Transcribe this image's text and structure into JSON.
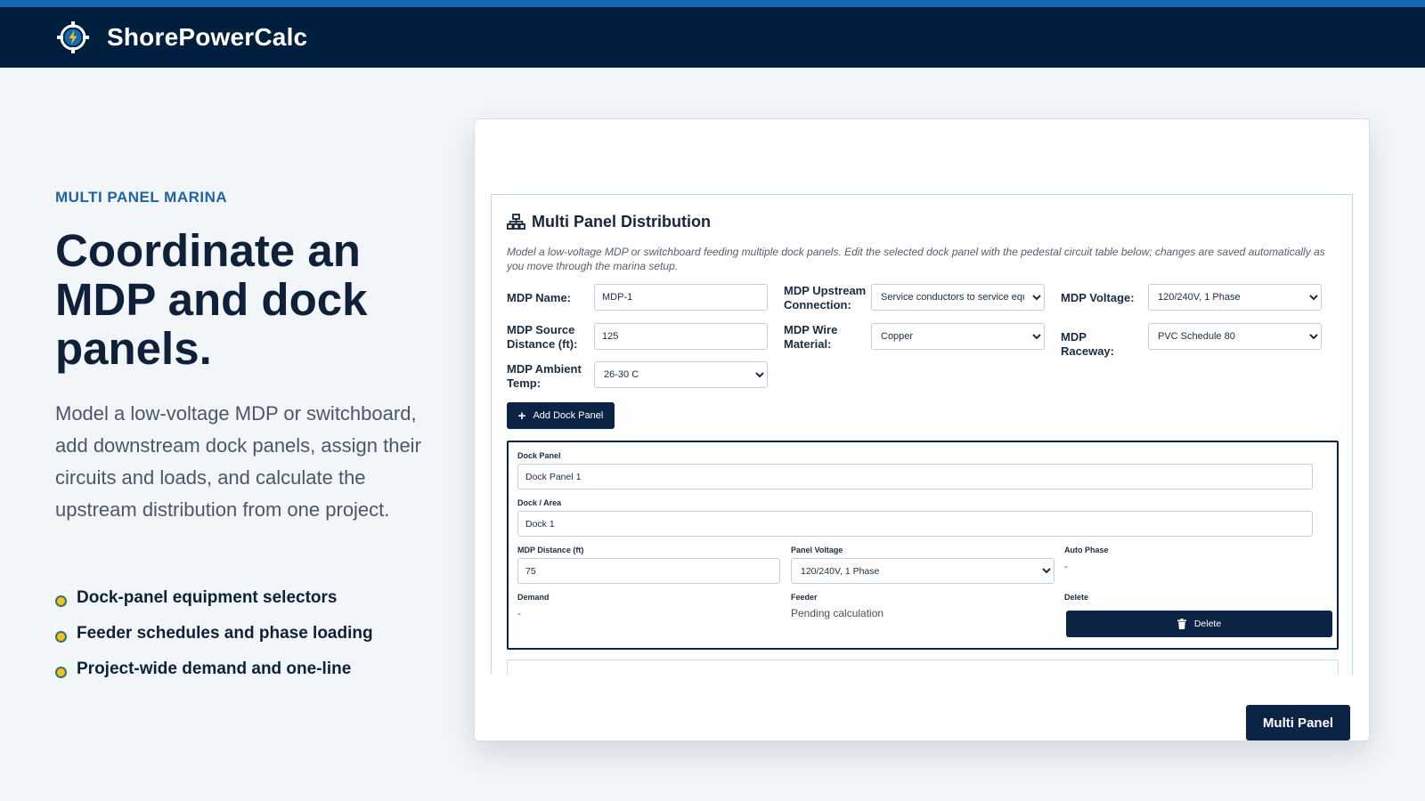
{
  "header": {
    "brand": "ShorePowerCalc",
    "logo_icon": "lightning-target-icon"
  },
  "hero": {
    "eyebrow": "MULTI PANEL MARINA",
    "headline": "Coordinate an MDP and dock panels.",
    "lede": "Model a low-voltage MDP or switchboard, add downstream dock panels, assign their circuits and loads, and calculate the upstream distribution from one project.",
    "features": [
      "Dock-panel equipment selectors",
      "Feeder schedules and phase loading",
      "Project-wide demand and one-line"
    ]
  },
  "colors": {
    "topbar": "#001e3d",
    "topbar_accent": "#1668b0",
    "eyebrow": "#1d64a6",
    "bullet": "#f0c419",
    "primary_button": "#0b2446"
  },
  "section": {
    "icon": "network-icon",
    "title": "Multi Panel Distribution",
    "description": "Model a low-voltage MDP or switchboard feeding multiple dock panels. Edit the selected dock panel with the pedestal circuit table below; changes are saved automatically as you move through the marina setup."
  },
  "mdp": {
    "name_label": "MDP Name:",
    "name_value": "MDP-1",
    "upstream_label": "MDP Upstream Connection:",
    "upstream_value": "Service conductors to service equipment",
    "voltage_label": "MDP Voltage:",
    "voltage_value": "120/240V, 1 Phase",
    "distance_label": "MDP Source Distance (ft):",
    "distance_value": "125",
    "wire_label": "MDP Wire Material:",
    "wire_value": "Copper",
    "raceway_label": "MDP Raceway:",
    "raceway_value": "PVC Schedule 80",
    "ambient_label": "MDP Ambient Temp:",
    "ambient_value": "26-30 C"
  },
  "add_button": {
    "icon": "plus-icon",
    "label": "Add Dock Panel"
  },
  "dock_panel": {
    "panel_label": "Dock Panel",
    "panel_value": "Dock Panel 1",
    "area_label": "Dock / Area",
    "area_value": "Dock 1",
    "distance_label": "MDP Distance (ft)",
    "distance_value": "75",
    "voltage_label": "Panel Voltage",
    "voltage_value": "120/240V, 1 Phase",
    "auto_phase_label": "Auto Phase",
    "auto_phase_value": "-",
    "demand_label": "Demand",
    "demand_value": "-",
    "feeder_label": "Feeder",
    "feeder_value": "Pending calculation",
    "delete_label": "Delete",
    "delete_button": "Delete",
    "delete_icon": "trash-icon"
  },
  "footer_button": {
    "label": "Multi Panel"
  }
}
